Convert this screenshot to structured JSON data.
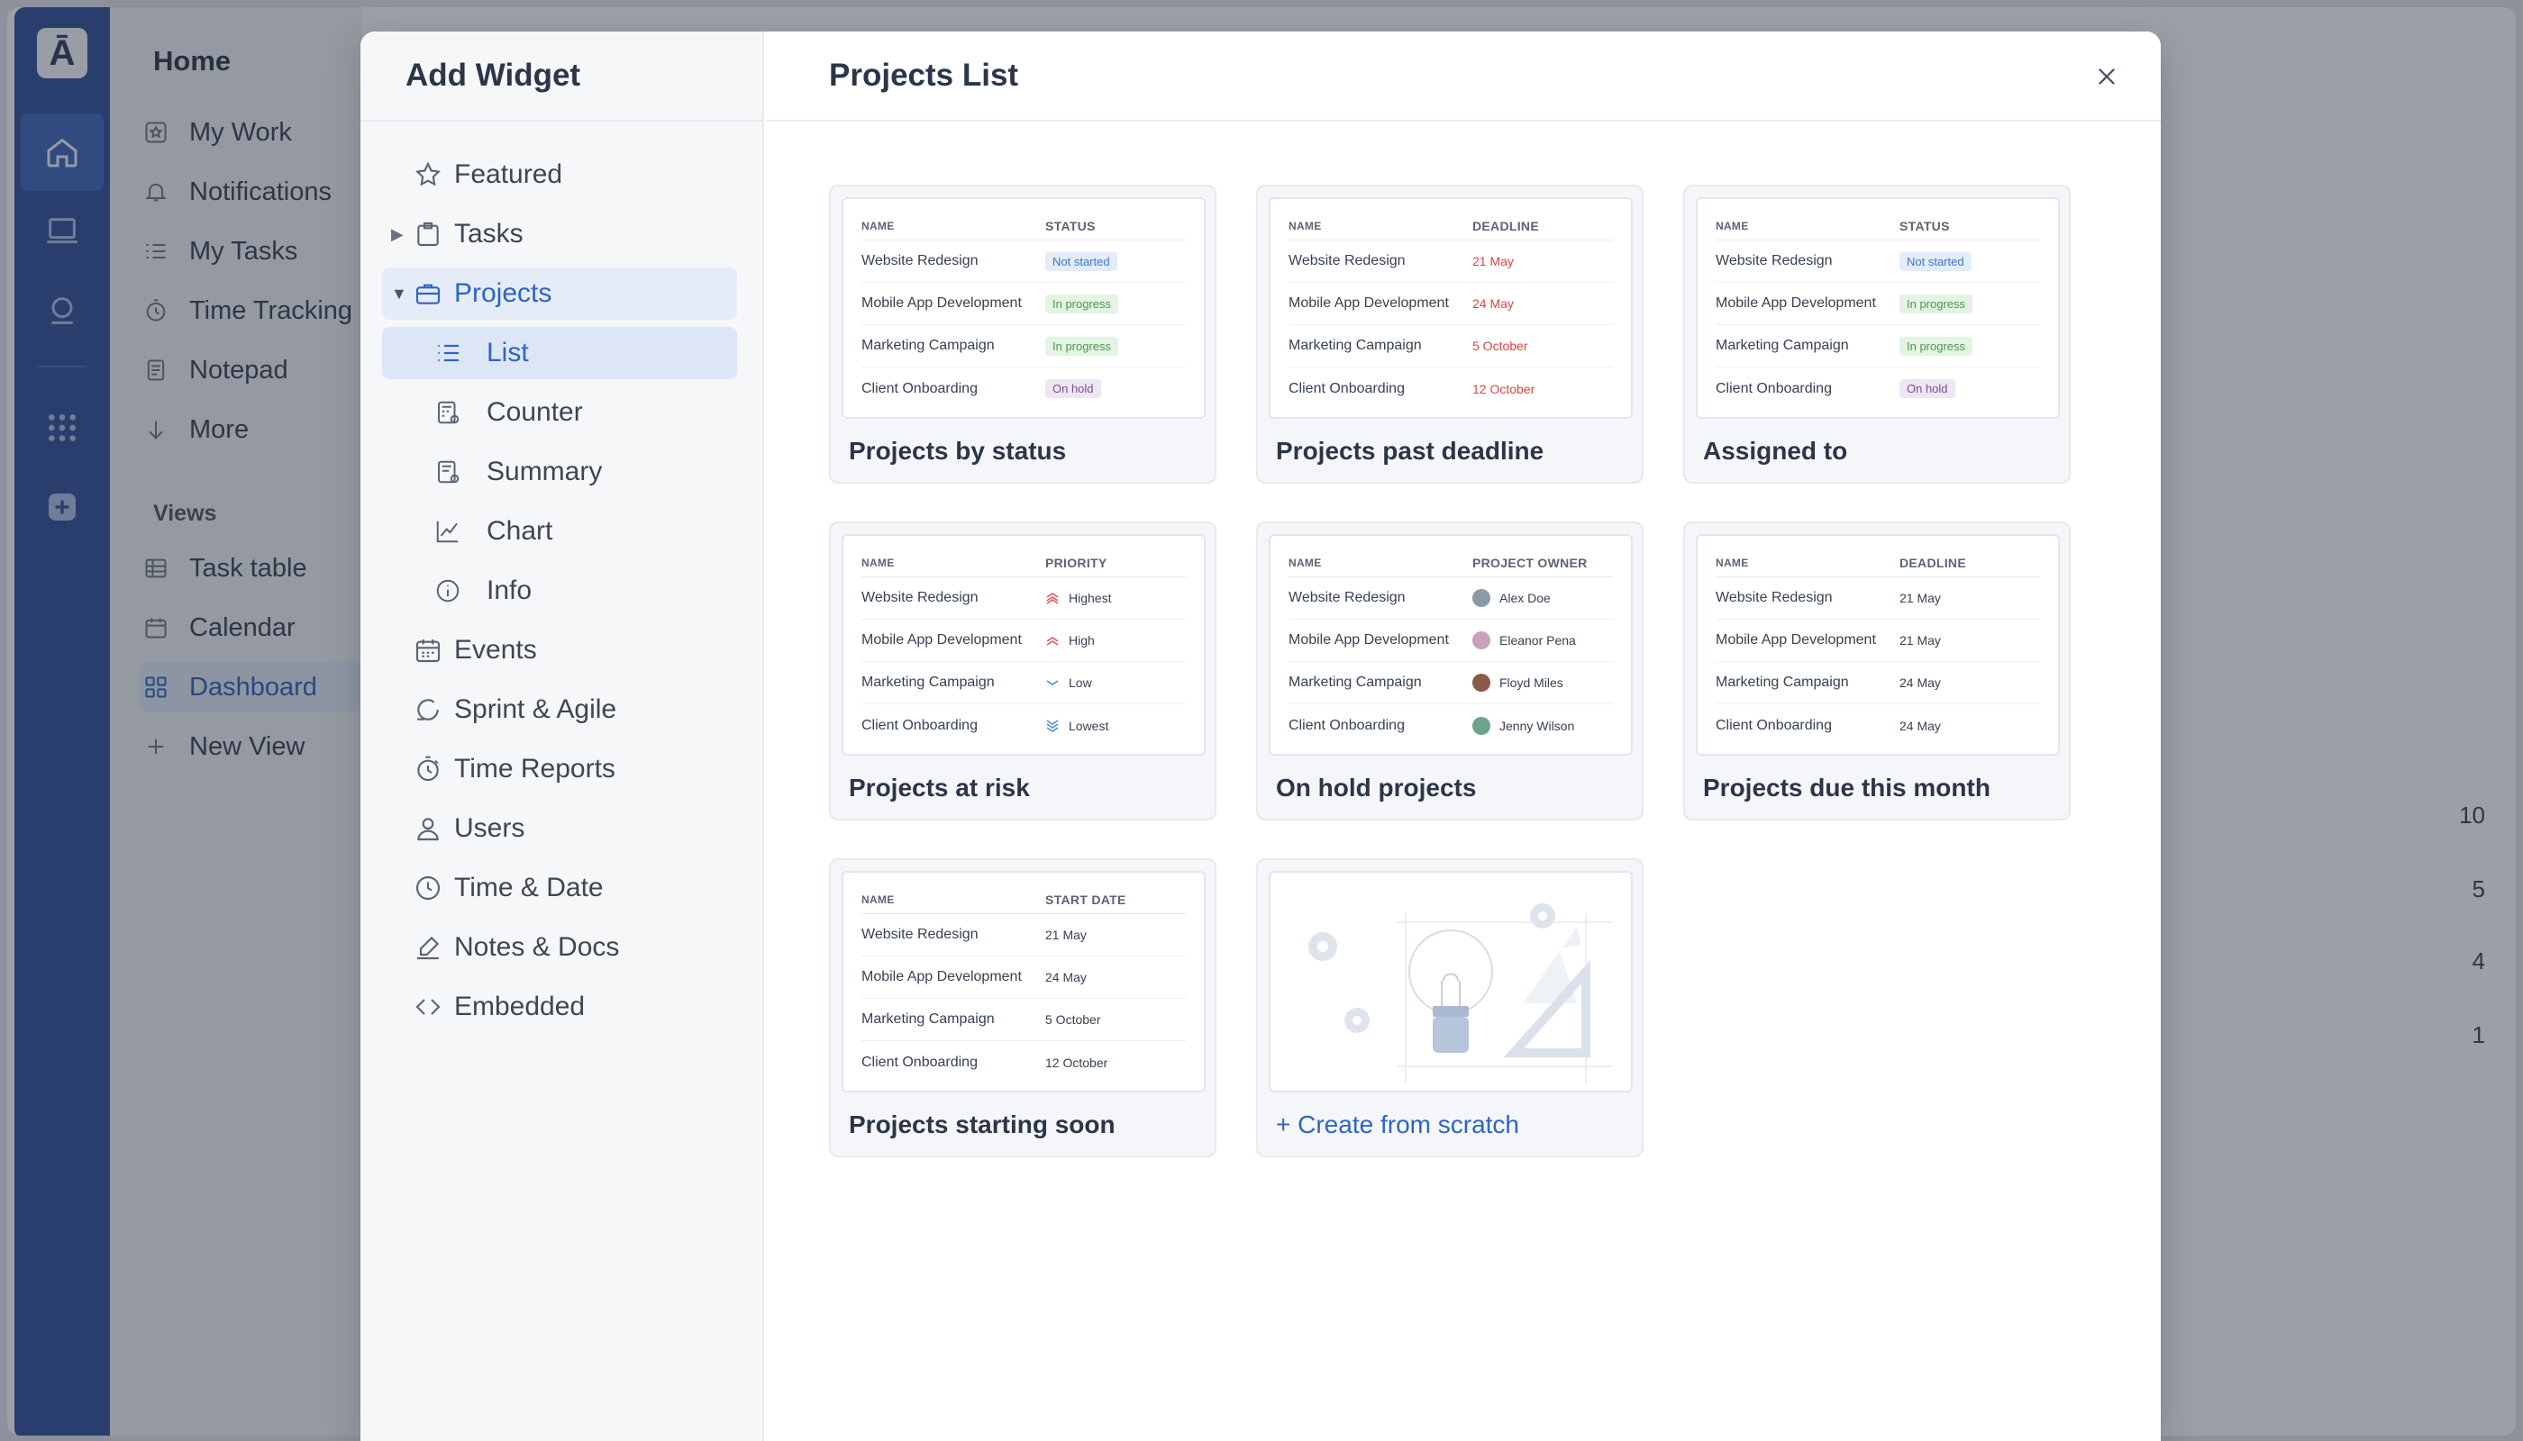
{
  "app": {
    "sidebar_title": "Home",
    "nav": [
      {
        "label": "My Work",
        "icon": "star-square-icon"
      },
      {
        "label": "Notifications",
        "icon": "bell-icon"
      },
      {
        "label": "My Tasks",
        "icon": "checklist-icon"
      },
      {
        "label": "Time Tracking",
        "icon": "stopwatch-icon"
      },
      {
        "label": "Notepad",
        "icon": "notepad-icon"
      },
      {
        "label": "More",
        "icon": "arrow-down-icon"
      }
    ],
    "views_label": "Views",
    "views": [
      {
        "label": "Task table",
        "icon": "table-icon"
      },
      {
        "label": "Calendar",
        "icon": "calendar-icon"
      },
      {
        "label": "Dashboard",
        "icon": "dashboard-icon"
      },
      {
        "label": "New View",
        "icon": "plus-icon"
      }
    ],
    "bg_numbers": [
      "10",
      "5",
      "4",
      "1"
    ]
  },
  "modal": {
    "left_title": "Add Widget",
    "right_title": "Projects List",
    "categories": {
      "featured": "Featured",
      "tasks": "Tasks",
      "projects": "Projects",
      "list": "List",
      "counter": "Counter",
      "summary": "Summary",
      "chart": "Chart",
      "info": "Info",
      "events": "Events",
      "sprint": "Sprint & Agile",
      "time_reports": "Time Reports",
      "users": "Users",
      "time_date": "Time & Date",
      "notes_docs": "Notes & Docs",
      "embedded": "Embedded"
    },
    "projects": [
      "Website Redesign",
      "Mobile App Development",
      "Marketing Campaign",
      "Client Onboarding"
    ],
    "cards": {
      "by_status": {
        "title": "Projects by status",
        "col1": "NAME",
        "col2": "STATUS",
        "values": [
          "Not started",
          "In progress",
          "In progress",
          "On hold"
        ]
      },
      "past_deadline": {
        "title": "Projects past deadline",
        "col1": "NAME",
        "col2": "DEADLINE",
        "values": [
          "21 May",
          "24 May",
          "5 October",
          "12 October"
        ]
      },
      "assigned_to": {
        "title": "Assigned to",
        "col1": "NAME",
        "col2": "STATUS",
        "values": [
          "Not started",
          "In progress",
          "In progress",
          "On hold"
        ]
      },
      "at_risk": {
        "title": "Projects at risk",
        "col1": "NAME",
        "col2": "PRIORITY",
        "values": [
          "Highest",
          "High",
          "Low",
          "Lowest"
        ]
      },
      "on_hold": {
        "title": "On hold projects",
        "col1": "NAME",
        "col2": "PROJECT OWNER",
        "values": [
          "Alex Doe",
          "Eleanor Pena",
          "Floyd Miles",
          "Jenny Wilson"
        ]
      },
      "due_month": {
        "title": "Projects due this month",
        "col1": "NAME",
        "col2": "DEADLINE",
        "values": [
          "21 May",
          "21 May",
          "24 May",
          "24 May"
        ]
      },
      "starting_soon": {
        "title": "Projects starting soon",
        "col1": "NAME",
        "col2": "START DATE",
        "values": [
          "21 May",
          "24 May",
          "5 October",
          "12 October"
        ]
      },
      "scratch": {
        "title": "Create from scratch",
        "prefix": "+"
      }
    }
  },
  "colors": {
    "accent": "#2f64c2",
    "rail": "#2f4f94",
    "priority_high": "#e05a5a",
    "priority_low": "#4f8fd6"
  }
}
